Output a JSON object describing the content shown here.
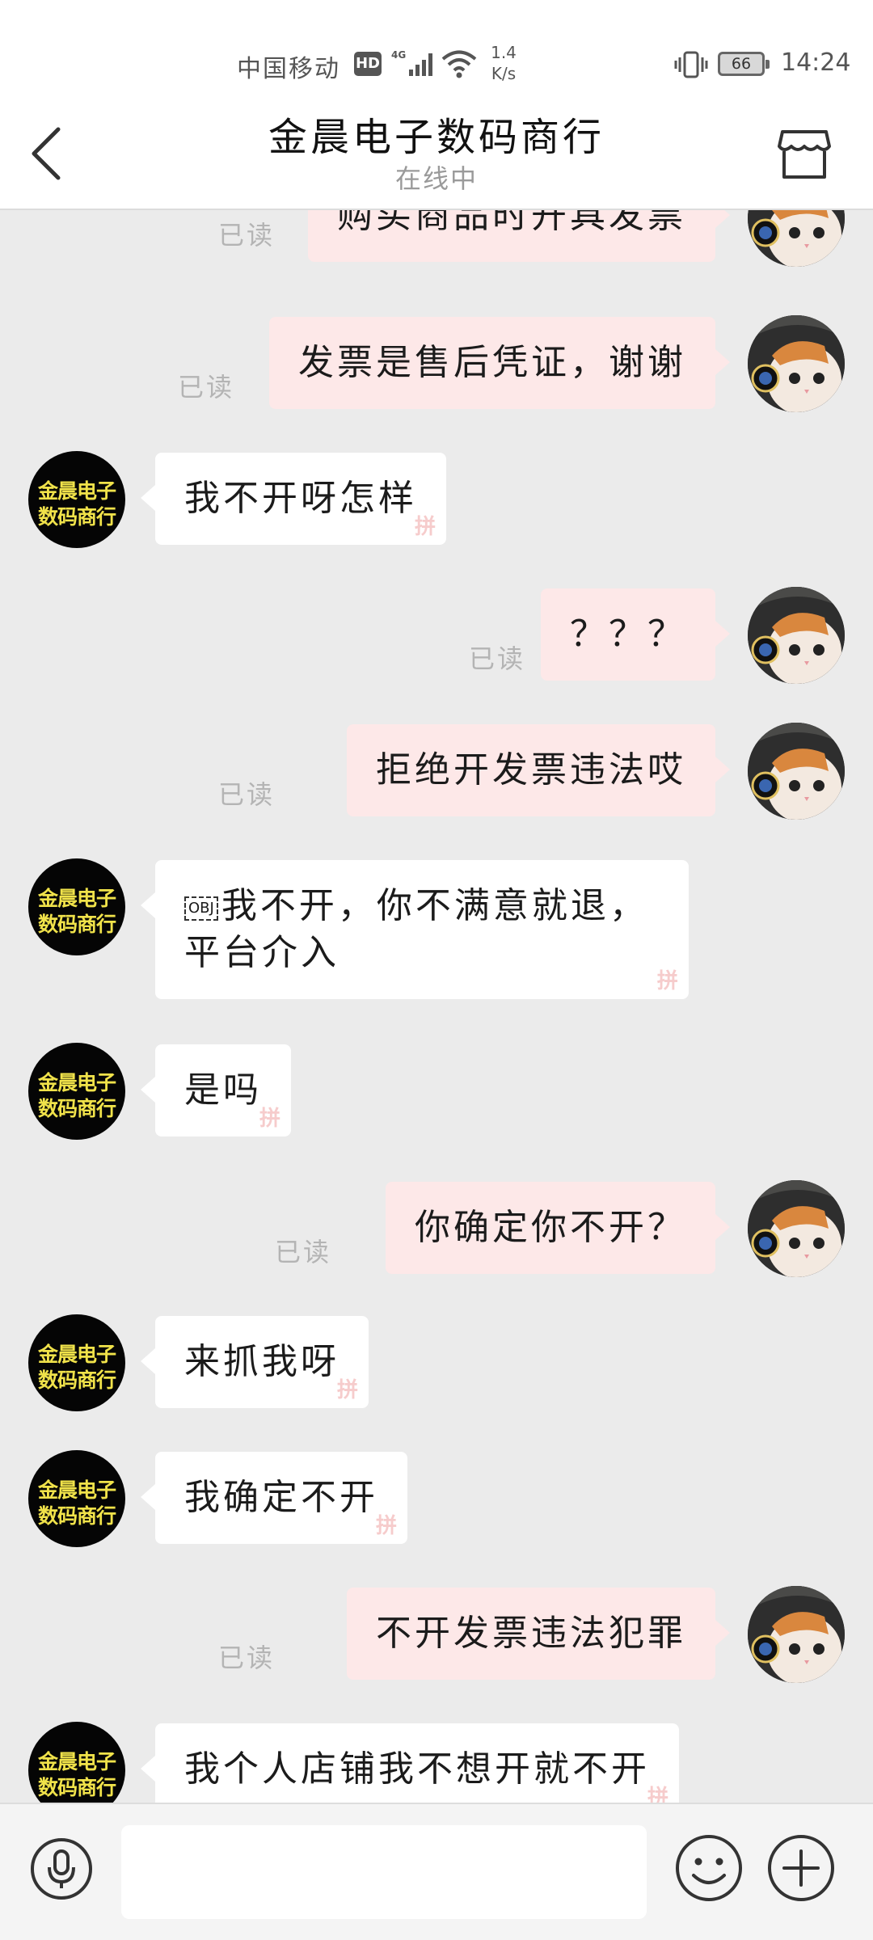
{
  "status_bar": {
    "carrier": "中国移动",
    "hd": "HD",
    "network": "4G",
    "speed_value": "1.4",
    "speed_unit": "K/s",
    "battery": "66",
    "time": "14:24"
  },
  "header": {
    "title": "金晨电子数码商行",
    "status": "在线中"
  },
  "seller_avatar": {
    "line1": "金晨电子",
    "line2": "数码商行"
  },
  "read_label": "已读",
  "sticker_mark": "拼",
  "obj_placeholder": "OBJ",
  "messages": [
    {
      "from": "buyer",
      "text": "购买商品时开具发票",
      "read": true
    },
    {
      "from": "buyer",
      "text": "发票是售后凭证，谢谢",
      "read": true
    },
    {
      "from": "seller",
      "text": "我不开呀怎样"
    },
    {
      "from": "buyer",
      "text": "？？？",
      "read": true
    },
    {
      "from": "buyer",
      "text": "拒绝开发票违法哎",
      "read": true
    },
    {
      "from": "seller",
      "line1": "我不开，你不满意就退，",
      "line2": "平台介入"
    },
    {
      "from": "seller",
      "text": "是吗"
    },
    {
      "from": "buyer",
      "text": "你确定你不开？",
      "read": true
    },
    {
      "from": "seller",
      "text": "来抓我呀"
    },
    {
      "from": "seller",
      "text": "我确定不开"
    },
    {
      "from": "buyer",
      "text": "不开发票违法犯罪",
      "read": true
    },
    {
      "from": "seller",
      "text": "我个人店铺我不想开就不开"
    }
  ],
  "input": {
    "placeholder": ""
  }
}
